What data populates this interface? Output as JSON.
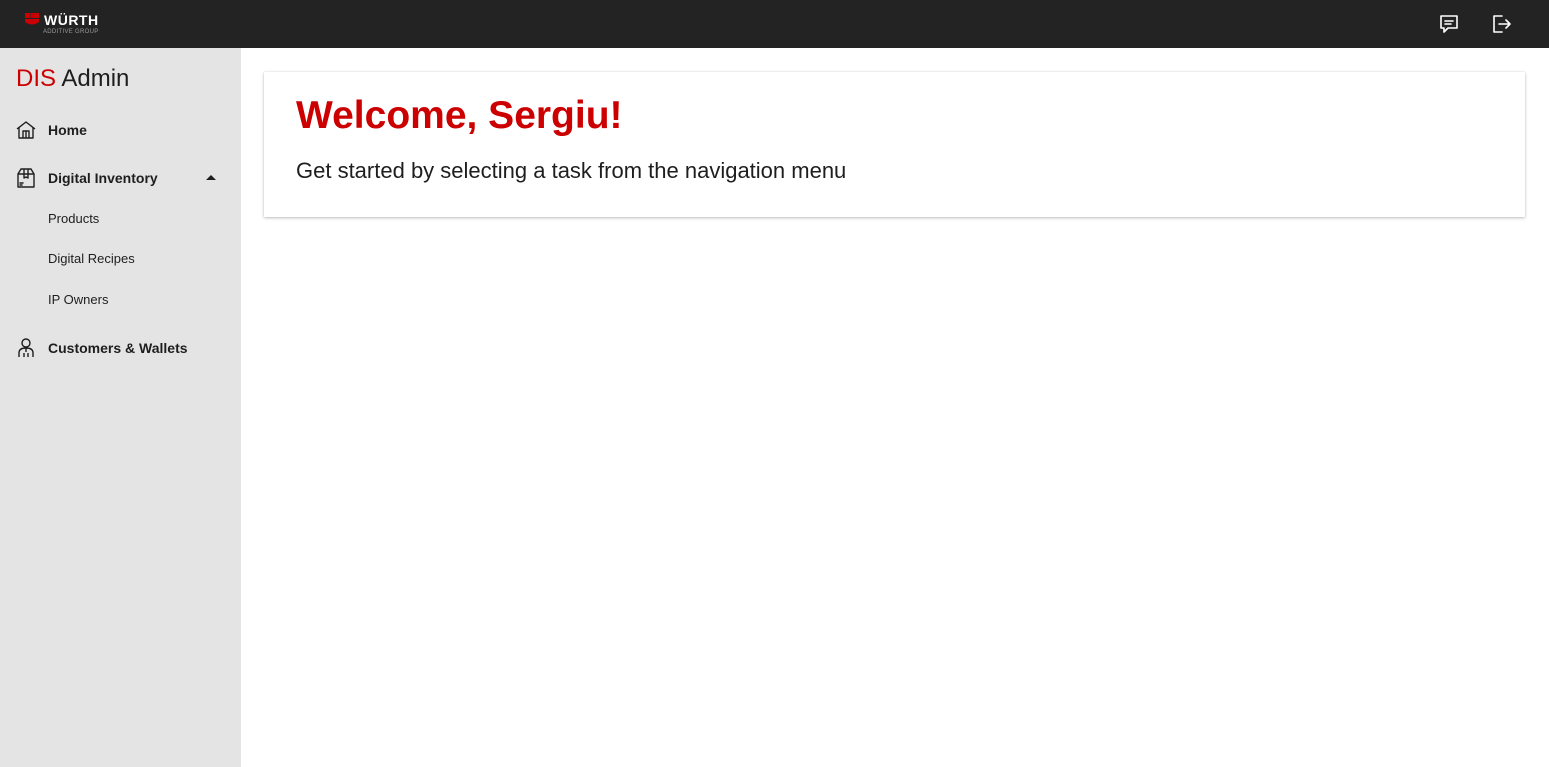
{
  "header": {
    "logo": {
      "wordmark": "WÜRTH",
      "subtitle": "ADDITIVE GROUP",
      "brand_color": "#cc0000"
    },
    "actions": [
      {
        "icon": "feedback-icon"
      },
      {
        "icon": "logout-icon"
      }
    ],
    "background": "#232323"
  },
  "sidebar": {
    "title_accent": "DIS",
    "title_rest": "Admin",
    "background": "#e4e4e4",
    "items": [
      {
        "label": "Home",
        "icon": "home-icon"
      },
      {
        "label": "Digital Inventory",
        "icon": "inventory-box-icon",
        "expanded": true,
        "children": [
          {
            "label": "Products"
          },
          {
            "label": "Digital Recipes"
          },
          {
            "label": "IP Owners"
          }
        ]
      },
      {
        "label": "Customers & Wallets",
        "icon": "person-icon"
      }
    ]
  },
  "main": {
    "welcome_title": "Welcome, Sergiu!",
    "welcome_subtitle": "Get started by selecting a task from the navigation menu",
    "accent_color": "#cc0000"
  }
}
